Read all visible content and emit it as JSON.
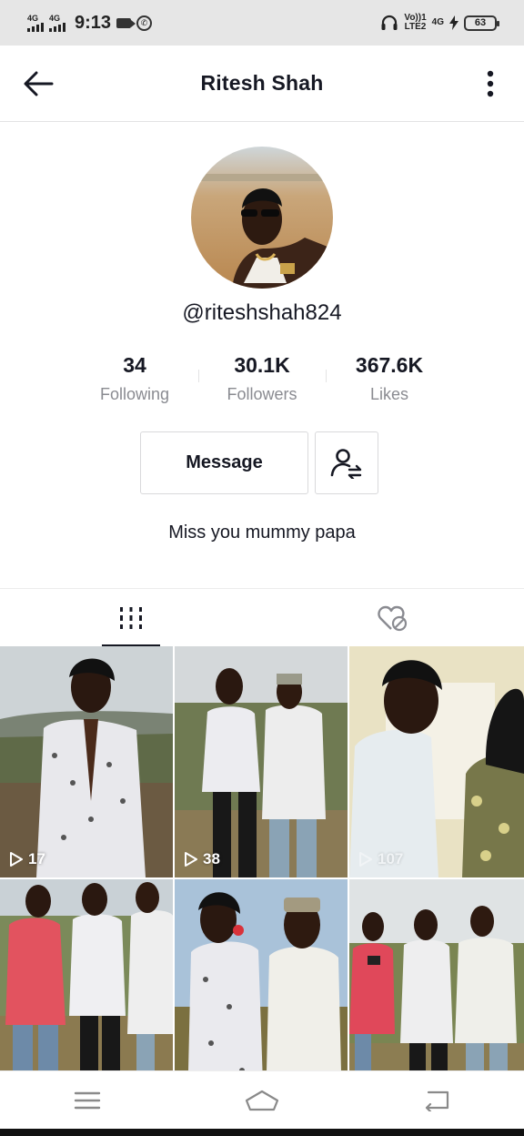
{
  "status_bar": {
    "network_1": "4G",
    "network_2": "4G",
    "time": "9:13",
    "volte_1": "Vo))",
    "volte_2": "LTE2",
    "sim_slot": "1",
    "network_3": "4G",
    "battery": "63"
  },
  "header": {
    "title": "Ritesh Shah"
  },
  "profile": {
    "username": "@riteshshah824",
    "stats": [
      {
        "value": "34",
        "label": "Following"
      },
      {
        "value": "30.1K",
        "label": "Followers"
      },
      {
        "value": "367.6K",
        "label": "Likes"
      }
    ],
    "message_label": "Message",
    "bio": "Miss you mummy papa"
  },
  "tabs": [
    {
      "name": "videos-tab",
      "icon": "grid-bars-icon",
      "active": true
    },
    {
      "name": "liked-tab",
      "icon": "hidden-heart-icon",
      "active": false
    }
  ],
  "videos": [
    {
      "views": "17"
    },
    {
      "views": "38"
    },
    {
      "views": "107"
    },
    {
      "views": ""
    },
    {
      "views": ""
    },
    {
      "views": ""
    }
  ],
  "colors": {
    "text_primary": "#161823",
    "text_secondary": "#8a8b91",
    "border": "#d9d9db",
    "status_bar_bg": "#e6e6e6"
  }
}
